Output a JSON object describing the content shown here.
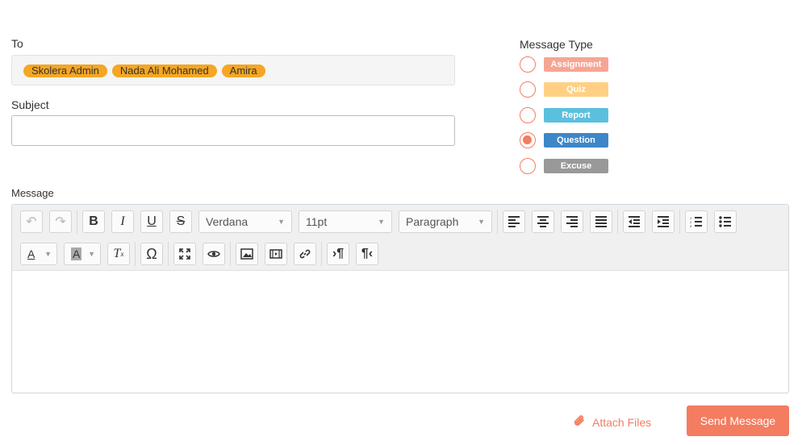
{
  "to": {
    "label": "To",
    "recipients": [
      "Skolera Admin",
      "Nada Ali Mohamed",
      "Amira"
    ]
  },
  "subject": {
    "label": "Subject",
    "value": ""
  },
  "message_type": {
    "label": "Message Type",
    "options": [
      {
        "label": "Assignment",
        "color": "#f7a593",
        "checked": false
      },
      {
        "label": "Quiz",
        "color": "#ffd084",
        "checked": false
      },
      {
        "label": "Report",
        "color": "#5bc0de",
        "checked": false
      },
      {
        "label": "Question",
        "color": "#3d87c8",
        "checked": true
      },
      {
        "label": "Excuse",
        "color": "#999999",
        "checked": false
      }
    ]
  },
  "message": {
    "label": "Message",
    "font_family": "Verdana",
    "font_size": "11pt",
    "block_format": "Paragraph",
    "body": ""
  },
  "actions": {
    "attach_label": "Attach Files",
    "send_label": "Send Message"
  },
  "colors": {
    "accent": "#f47c60",
    "chip": "#f5a623"
  }
}
